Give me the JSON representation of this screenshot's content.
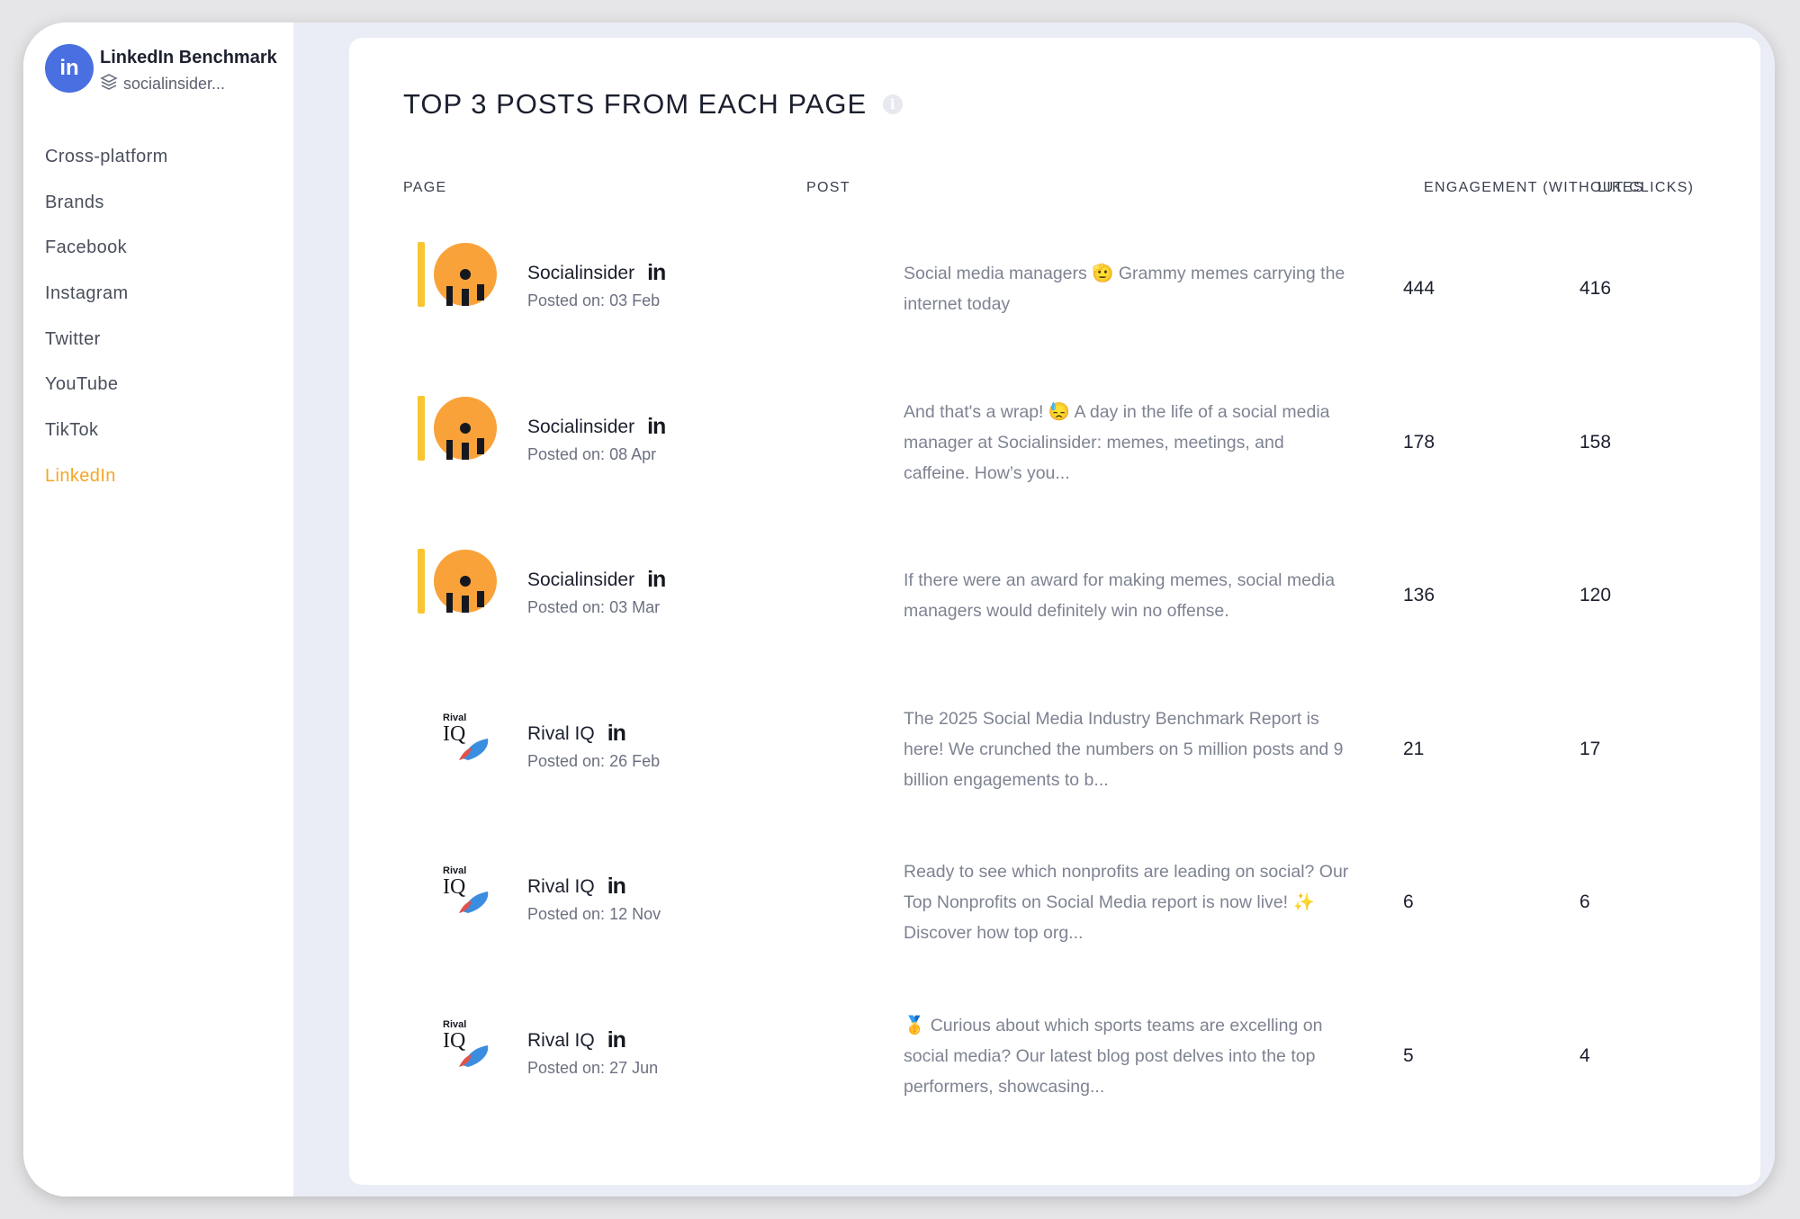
{
  "app": {
    "avatar_text": "in",
    "title": "LinkedIn Benchmark",
    "subtitle": "socialinsider..."
  },
  "nav": [
    "Cross-platform",
    "Brands",
    "Facebook",
    "Instagram",
    "Twitter",
    "YouTube",
    "TikTok",
    "LinkedIn"
  ],
  "active_nav": "LinkedIn",
  "table": {
    "title": "TOP 3 POSTS FROM EACH PAGE",
    "info_icon": "info-icon",
    "headers": {
      "page": "PAGE",
      "post": "POST",
      "engagement": "ENGAGEMENT (WITHOUT CLICKS)",
      "likes": "LIKES"
    },
    "rows": [
      {
        "page": "Socialinsider",
        "posted": "Posted on: 03 Feb",
        "text": "Social media managers 🫡 Grammy memes carrying the internet today",
        "engagement": "444",
        "likes": "416",
        "logo": "socialinsider"
      },
      {
        "page": "Socialinsider",
        "posted": "Posted on: 08 Apr",
        "text": "And that's a wrap! 😓 A day in the life of a social media manager at Socialinsider: memes, meetings, and caffeine. How’s you...",
        "engagement": "178",
        "likes": "158",
        "logo": "socialinsider"
      },
      {
        "page": "Socialinsider",
        "posted": "Posted on: 03 Mar",
        "text": "If there were an award for making memes, social media managers would definitely win no offense.",
        "engagement": "136",
        "likes": "120",
        "logo": "socialinsider"
      },
      {
        "page": "Rival IQ",
        "posted": "Posted on: 26 Feb",
        "text": "The 2025 Social Media Industry Benchmark Report is here! We crunched the numbers on 5 million posts and 9 billion engagements to b...",
        "engagement": "21",
        "likes": "17",
        "logo": "rivaliq"
      },
      {
        "page": "Rival IQ",
        "posted": "Posted on: 12 Nov",
        "text": "Ready to see which nonprofits are leading on social? Our Top Nonprofits on Social Media report is now live! ✨ Discover how top org...",
        "engagement": "6",
        "likes": "6",
        "logo": "rivaliq"
      },
      {
        "page": "Rival IQ",
        "posted": "Posted on: 27 Jun",
        "text": "🥇 Curious about which sports teams are excelling on social media? Our latest blog post delves into the top performers, showcasing...",
        "engagement": "5",
        "likes": "4",
        "logo": "rivaliq"
      }
    ],
    "linkedin_mark": "in",
    "rival_logo_text": {
      "top": "Rival",
      "bottom": "IQ"
    }
  },
  "colors": {
    "accent": "#f5a623",
    "brand_blue": "#4a6fe0",
    "socialinsider_orange": "#f9a23a",
    "highlight_bar": "#f7c630"
  }
}
